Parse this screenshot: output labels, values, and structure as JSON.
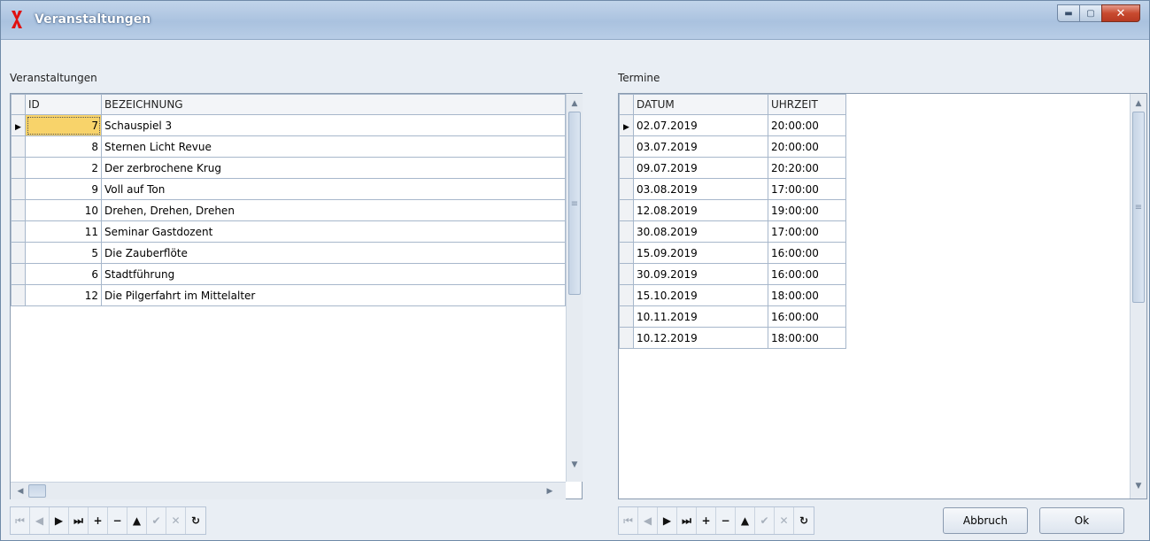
{
  "window": {
    "title": "Veranstaltungen"
  },
  "left": {
    "label": "Veranstaltungen",
    "columns": [
      "ID",
      "BEZEICHNUNG"
    ],
    "rows": [
      {
        "id": "7",
        "name": "Schauspiel 3"
      },
      {
        "id": "8",
        "name": "Sternen Licht Revue"
      },
      {
        "id": "2",
        "name": "Der zerbrochene Krug"
      },
      {
        "id": "9",
        "name": "Voll auf Ton"
      },
      {
        "id": "10",
        "name": "Drehen, Drehen, Drehen"
      },
      {
        "id": "11",
        "name": "Seminar Gastdozent"
      },
      {
        "id": "5",
        "name": "Die Zauberflöte"
      },
      {
        "id": "6",
        "name": "Stadtführung"
      },
      {
        "id": "12",
        "name": "Die Pilgerfahrt im Mittelalter"
      }
    ]
  },
  "right": {
    "label": "Termine",
    "columns": [
      "DATUM",
      "UHRZEIT"
    ],
    "rows": [
      {
        "date": "02.07.2019",
        "time": "20:00:00"
      },
      {
        "date": "03.07.2019",
        "time": "20:00:00"
      },
      {
        "date": "09.07.2019",
        "time": "20:20:00"
      },
      {
        "date": "03.08.2019",
        "time": "17:00:00"
      },
      {
        "date": "12.08.2019",
        "time": "19:00:00"
      },
      {
        "date": "30.08.2019",
        "time": "17:00:00"
      },
      {
        "date": "15.09.2019",
        "time": "16:00:00"
      },
      {
        "date": "30.09.2019",
        "time": "16:00:00"
      },
      {
        "date": "15.10.2019",
        "time": "18:00:00"
      },
      {
        "date": "10.11.2019",
        "time": "16:00:00"
      },
      {
        "date": "10.12.2019",
        "time": "18:00:00"
      }
    ]
  },
  "navigator": {
    "buttons": [
      {
        "name": "first",
        "glyph": "⏮",
        "enabled": false
      },
      {
        "name": "prior",
        "glyph": "◀",
        "enabled": false
      },
      {
        "name": "next",
        "glyph": "▶",
        "enabled": true
      },
      {
        "name": "last",
        "glyph": "⏭",
        "enabled": true
      },
      {
        "name": "insert",
        "glyph": "+",
        "enabled": true
      },
      {
        "name": "delete",
        "glyph": "−",
        "enabled": true
      },
      {
        "name": "edit",
        "glyph": "▲",
        "enabled": true
      },
      {
        "name": "post",
        "glyph": "✔",
        "enabled": false
      },
      {
        "name": "cancel",
        "glyph": "✕",
        "enabled": false
      },
      {
        "name": "refresh",
        "glyph": "↻",
        "enabled": true
      }
    ]
  },
  "buttons": {
    "cancel": "Abbruch",
    "ok": "Ok"
  },
  "colors": {
    "accent": "#f8d36a",
    "close": "#c84a2f",
    "title_bg": "#aac2df"
  }
}
